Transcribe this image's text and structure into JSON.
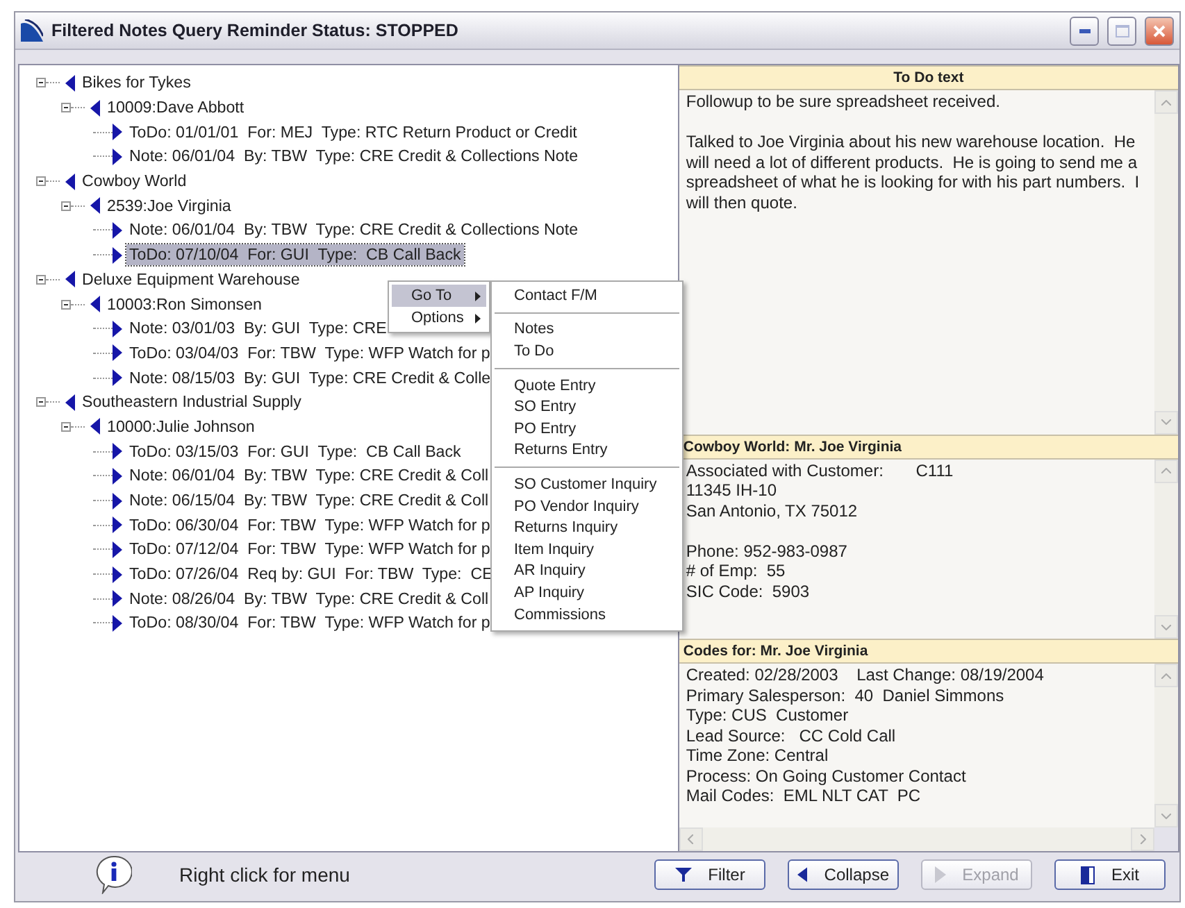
{
  "window": {
    "title": "Filtered Notes Query  Reminder Status: STOPPED"
  },
  "tree": [
    {
      "label": "Bikes for Tykes",
      "expanded": true,
      "children": [
        {
          "label": "10009:Dave Abbott",
          "expanded": true,
          "children": [
            {
              "label": "ToDo: 01/01/01  For: MEJ  Type: RTC Return Product or Credit",
              "selected": false
            },
            {
              "label": "Note: 06/01/04  By: TBW  Type: CRE Credit & Collections Note",
              "selected": false
            }
          ]
        }
      ]
    },
    {
      "label": "Cowboy World",
      "expanded": true,
      "children": [
        {
          "label": "2539:Joe Virginia",
          "expanded": true,
          "children": [
            {
              "label": "Note: 06/01/04  By: TBW  Type: CRE Credit & Collections Note",
              "selected": false
            },
            {
              "label": "ToDo: 07/10/04  For: GUI  Type:  CB Call Back",
              "selected": true
            }
          ]
        }
      ]
    },
    {
      "label": "Deluxe Equipment Warehouse",
      "expanded": true,
      "children": [
        {
          "label": "10003:Ron Simonsen",
          "expanded": true,
          "children": [
            {
              "label": "Note: 03/01/03  By: GUI  Type: CRE",
              "selected": false
            },
            {
              "label": "ToDo: 03/04/03  For: TBW  Type: WFP Watch for p",
              "selected": false
            },
            {
              "label": "Note: 08/15/03  By: GUI  Type: CRE Credit & Colle",
              "selected": false
            }
          ]
        }
      ]
    },
    {
      "label": "Southeastern Industrial Supply",
      "expanded": true,
      "children": [
        {
          "label": "10000:Julie Johnson",
          "expanded": true,
          "children": [
            {
              "label": "ToDo: 03/15/03  For: GUI  Type:  CB Call Back",
              "selected": false
            },
            {
              "label": "Note: 06/01/04  By: TBW  Type: CRE Credit & Coll",
              "selected": false
            },
            {
              "label": "Note: 06/15/04  By: TBW  Type: CRE Credit & Coll",
              "selected": false
            },
            {
              "label": "ToDo: 06/30/04  For: TBW  Type: WFP Watch for p",
              "selected": false
            },
            {
              "label": "ToDo: 07/12/04  For: TBW  Type: WFP Watch for p",
              "selected": false
            },
            {
              "label": "ToDo: 07/26/04  Req by: GUI  For: TBW  Type:  CE",
              "selected": false
            },
            {
              "label": "Note: 08/26/04  By: TBW  Type: CRE Credit & Coll",
              "selected": false
            },
            {
              "label": "ToDo: 08/30/04  For: TBW  Type: WFP Watch for p",
              "selected": false
            }
          ]
        }
      ]
    }
  ],
  "context_menu": {
    "items": [
      {
        "label": "Go To",
        "selected": true
      },
      {
        "label": "Options",
        "selected": false
      }
    ],
    "submenu_groups": [
      [
        "Contact F/M"
      ],
      [
        "Notes",
        "To Do"
      ],
      [
        "Quote Entry",
        "SO Entry",
        "PO Entry",
        "Returns Entry"
      ],
      [
        "SO Customer Inquiry",
        "PO Vendor Inquiry",
        "Returns Inquiry",
        "Item Inquiry",
        "AR Inquiry",
        "AP Inquiry",
        "Commissions"
      ]
    ]
  },
  "todo_panel": {
    "header": "To Do text",
    "paragraphs": [
      [
        "Followup to be sure spreadsheet received."
      ],
      [
        "Talked to Joe Virginia about his new warehouse location.  He will need a lot of different products.  He is going to send me a spreadsheet of what he is looking for with his part numbers.  I will then quote."
      ]
    ]
  },
  "contact_panel": {
    "header": "Cowboy World: Mr. Joe Virginia",
    "paragraphs": [
      [
        "Associated with Customer:       C111",
        "11345 IH-10",
        "San Antonio, TX 75012"
      ],
      [
        "Phone: 952-983-0987",
        "# of Emp:  55",
        "SIC Code:  5903"
      ]
    ]
  },
  "codes_panel": {
    "header": "Codes for: Mr. Joe Virginia",
    "paragraphs": [
      [
        "Created: 02/28/2003    Last Change: 08/19/2004",
        "Primary Salesperson:  40  Daniel Simmons",
        "Type: CUS  Customer",
        "Lead Source:   CC Cold Call",
        "Time Zone: Central",
        "Process: On Going Customer Contact",
        "Mail Codes:  EML NLT CAT  PC"
      ]
    ]
  },
  "status_bar": {
    "hint": "Right click for menu"
  },
  "buttons": [
    {
      "kind": "filter",
      "label": "Filter",
      "disabled": false
    },
    {
      "kind": "collapse",
      "label": "Collapse",
      "disabled": false
    },
    {
      "kind": "expand",
      "label": "Expand",
      "disabled": true
    },
    {
      "kind": "exit",
      "label": "Exit",
      "disabled": false
    }
  ]
}
